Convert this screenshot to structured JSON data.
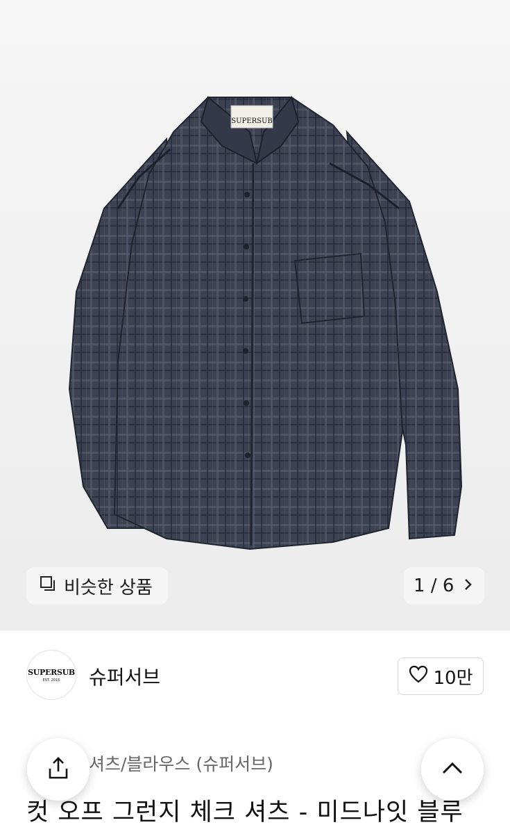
{
  "gallery": {
    "similar_label": "비슷한 상품",
    "counter": "1 / 6",
    "next_icon": "chevron-right-icon",
    "similar_icon": "copy-squares-icon",
    "background": "#efefef",
    "product_colors": {
      "shirt_main": "#3b4150",
      "shirt_dark": "#262b36"
    },
    "garment_label": "SUPERSUB"
  },
  "seller": {
    "logo_text": "SUPERSUB",
    "logo_subtext": "EST. 2015",
    "name": "슈퍼서브",
    "like_icon": "heart-outline-icon",
    "like_count": "10만"
  },
  "product": {
    "category": "셔츠/블라우스 (슈퍼서브)",
    "title": "컷 오프 그런지 체크 셔츠 - 미드나잇 블루"
  },
  "floating": {
    "share_icon": "share-icon",
    "scroll_top_icon": "chevron-up-icon"
  }
}
